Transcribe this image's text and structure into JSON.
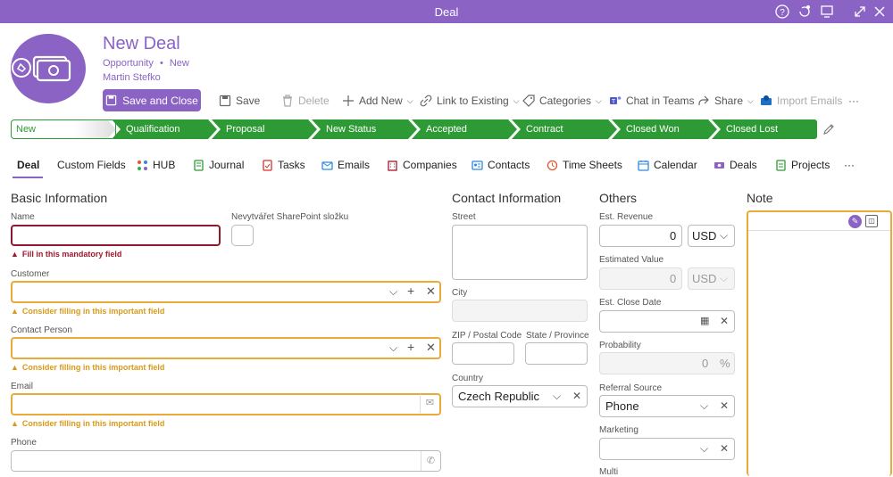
{
  "window": {
    "title": "Deal",
    "icons": [
      "help-icon",
      "update-icon",
      "screen-icon",
      "expand-icon",
      "close-icon"
    ]
  },
  "header": {
    "title": "New Deal",
    "type": "Opportunity",
    "separator": "•",
    "status": "New",
    "owner": "Martin Stefko"
  },
  "toolbar": {
    "save_close": "Save and Close",
    "save": "Save",
    "delete": "Delete",
    "add_new": "Add New",
    "link_existing": "Link to Existing",
    "categories": "Categories",
    "chat_teams": "Chat in Teams",
    "share": "Share",
    "import_emails": "Import Emails",
    "more": "···"
  },
  "stages": [
    "New",
    "Qualification",
    "Proposal",
    "New Status",
    "Accepted",
    "Contract",
    "Closed Won",
    "Closed Lost"
  ],
  "tabs": [
    "Deal",
    "Custom Fields",
    "HUB",
    "Journal",
    "Tasks",
    "Emails",
    "Companies",
    "Contacts",
    "Time Sheets",
    "Calendar",
    "Deals",
    "Projects",
    "···"
  ],
  "basic": {
    "title": "Basic Information",
    "name_label": "Name",
    "name_error": "Fill in this mandatory field",
    "sharepoint_label": "Nevytvářet SharePoint složku",
    "customer_label": "Customer",
    "customer_warn": "Consider filling in this important field",
    "contact_label": "Contact Person",
    "contact_warn": "Consider filling in this important field",
    "email_label": "Email",
    "email_warn": "Consider filling in this important field",
    "phone_label": "Phone"
  },
  "contact": {
    "title": "Contact Information",
    "street_label": "Street",
    "city_label": "City",
    "zip_label": "ZIP / Postal Code",
    "state_label": "State / Province",
    "country_label": "Country",
    "country_value": "Czech Republic"
  },
  "others": {
    "title": "Others",
    "revenue_label": "Est. Revenue",
    "revenue_value": "0",
    "revenue_currency": "USD",
    "value_label": "Estimated Value",
    "value_value": "0",
    "value_currency": "USD",
    "close_date_label": "Est. Close Date",
    "probability_label": "Probability",
    "probability_value": "0",
    "probability_unit": "%",
    "referral_label": "Referral Source",
    "referral_value": "Phone",
    "marketing_label": "Marketing",
    "multi_label": "Multi"
  },
  "note": {
    "title": "Note"
  },
  "colors": {
    "brand": "#8a63c4",
    "stage_green": "#2e9a36",
    "error": "#a3172d",
    "warning": "#eaaa3a"
  }
}
